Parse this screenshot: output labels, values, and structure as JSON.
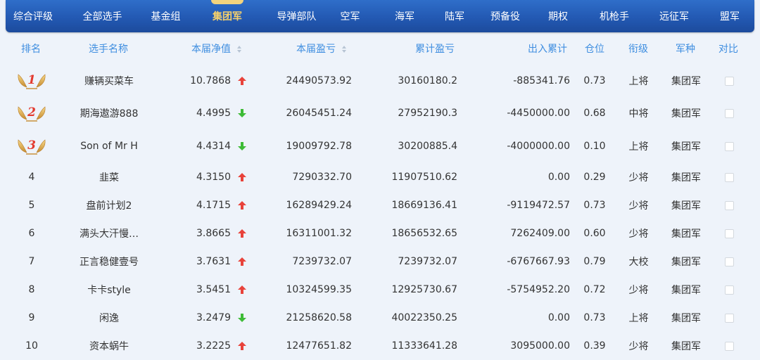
{
  "nav": {
    "tabs": [
      "综合评级",
      "全部选手",
      "基金组",
      "集团军",
      "导弹部队",
      "空军",
      "海军",
      "陆军",
      "预备役",
      "期权",
      "机枪手",
      "远征军",
      "盟军"
    ],
    "active": "集团军"
  },
  "table": {
    "headers": {
      "rank": "排名",
      "name": "选手名称",
      "nav": "本届净值",
      "profit": "本届盈亏",
      "cum_profit": "累计盈亏",
      "inout": "出入累计",
      "position": "仓位",
      "title": "衔级",
      "army": "军种",
      "compare": "对比"
    },
    "rows": [
      {
        "rank": "1",
        "medal": true,
        "name": "赚辆买菜车",
        "nav": "10.7868",
        "trend": "up",
        "profit": "24490573.92",
        "cum_profit": "30160180.2",
        "inout": "-885341.76",
        "position": "0.73",
        "title": "上将",
        "army": "集团军"
      },
      {
        "rank": "2",
        "medal": true,
        "name": "期海遨游888",
        "nav": "4.4995",
        "trend": "down",
        "profit": "26045451.24",
        "cum_profit": "27952190.3",
        "inout": "-4450000.00",
        "position": "0.68",
        "title": "中将",
        "army": "集团军"
      },
      {
        "rank": "3",
        "medal": true,
        "name": "Son of Mr H",
        "nav": "4.4314",
        "trend": "down",
        "profit": "19009792.78",
        "cum_profit": "30200885.4",
        "inout": "-4000000.00",
        "position": "0.10",
        "title": "上将",
        "army": "集团军"
      },
      {
        "rank": "4",
        "medal": false,
        "name": "韭菜",
        "nav": "4.3150",
        "trend": "up",
        "profit": "7290332.70",
        "cum_profit": "11907510.62",
        "inout": "0.00",
        "position": "0.29",
        "title": "少将",
        "army": "集团军"
      },
      {
        "rank": "5",
        "medal": false,
        "name": "盘前计划2",
        "nav": "4.1715",
        "trend": "up",
        "profit": "16289429.24",
        "cum_profit": "18669136.41",
        "inout": "-9119472.57",
        "position": "0.73",
        "title": "少将",
        "army": "集团军"
      },
      {
        "rank": "6",
        "medal": false,
        "name": "满头大汗慢…",
        "nav": "3.8665",
        "trend": "up",
        "profit": "16311001.32",
        "cum_profit": "18656532.65",
        "inout": "7262409.00",
        "position": "0.60",
        "title": "少将",
        "army": "集团军"
      },
      {
        "rank": "7",
        "medal": false,
        "name": "正言稳健壹号",
        "nav": "3.7631",
        "trend": "up",
        "profit": "7239732.07",
        "cum_profit": "7239732.07",
        "inout": "-6767667.93",
        "position": "0.79",
        "title": "大校",
        "army": "集团军"
      },
      {
        "rank": "8",
        "medal": false,
        "name": "卡卡style",
        "nav": "3.5451",
        "trend": "up",
        "profit": "10324599.35",
        "cum_profit": "12925730.67",
        "inout": "-5754952.20",
        "position": "0.72",
        "title": "少将",
        "army": "集团军"
      },
      {
        "rank": "9",
        "medal": false,
        "name": "闲逸",
        "nav": "3.2479",
        "trend": "down",
        "profit": "21258620.58",
        "cum_profit": "40022350.25",
        "inout": "0.00",
        "position": "0.73",
        "title": "上将",
        "army": "集团军"
      },
      {
        "rank": "10",
        "medal": false,
        "name": "资本蜗牛",
        "nav": "3.2225",
        "trend": "up",
        "profit": "12477651.82",
        "cum_profit": "11333641.28",
        "inout": "3095000.00",
        "position": "0.39",
        "title": "少将",
        "army": "集团军"
      }
    ]
  },
  "colors": {
    "up": "#e8423a",
    "down": "#3dbb36",
    "header_text": "#3f8ee0",
    "nav_active": "#f7d16b"
  },
  "icons": {
    "sort": "sort-icon",
    "up": "arrow-up-icon",
    "down": "arrow-down-icon",
    "medal": "laurel-medal-icon"
  }
}
